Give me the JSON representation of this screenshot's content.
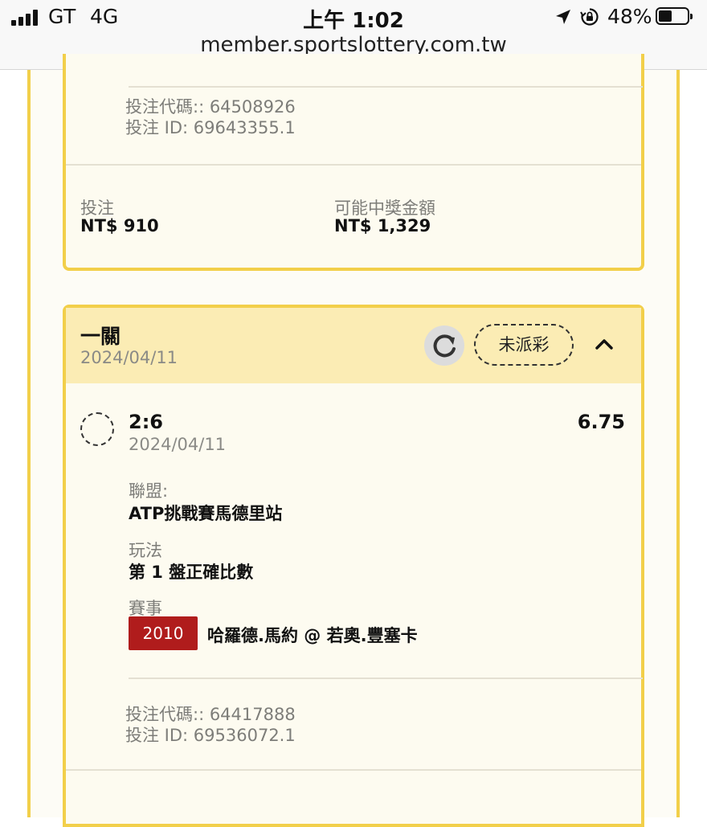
{
  "status_bar": {
    "carrier": "GT",
    "network": "4G",
    "time": "上午 1:02",
    "battery_percent": "48%",
    "battery_level": 0.48,
    "url": "member.sportslottery.com.tw"
  },
  "bet_card_previous": {
    "bet_code": "投注代碼:: 64508926",
    "bet_id": "投注 ID: 69643355.1",
    "stake_label": "投注",
    "stake_value": "NT$ 910",
    "payout_label": "可能中獎金額",
    "payout_value": "NT$ 1,329"
  },
  "bet_card": {
    "title": "一關",
    "date": "2024/04/11",
    "status": "未派彩",
    "selection": {
      "pick": "2:6",
      "date": "2024/04/11",
      "odds": "6.75",
      "league_label": "聯盟:",
      "league_value": "ATP挑戰賽馬德里站",
      "market_label": "玩法",
      "market_value": "第 1 盤正確比數",
      "event_label": "賽事",
      "event_code": "2010",
      "event_name": "哈羅德.馬約 @ 若奧.豐塞卡"
    },
    "bet_code": "投注代碼:: 64417888",
    "bet_id": "投注 ID: 69536072.1"
  },
  "colors": {
    "accent_border": "#f2cf4a",
    "header_bg": "#fbecb4",
    "event_badge": "#b01c1c"
  },
  "icons": [
    "signal-icon",
    "location-arrow-icon",
    "rotation-lock-icon",
    "battery-icon",
    "refresh-icon",
    "chevron-up-icon",
    "pending-circle-icon"
  ]
}
